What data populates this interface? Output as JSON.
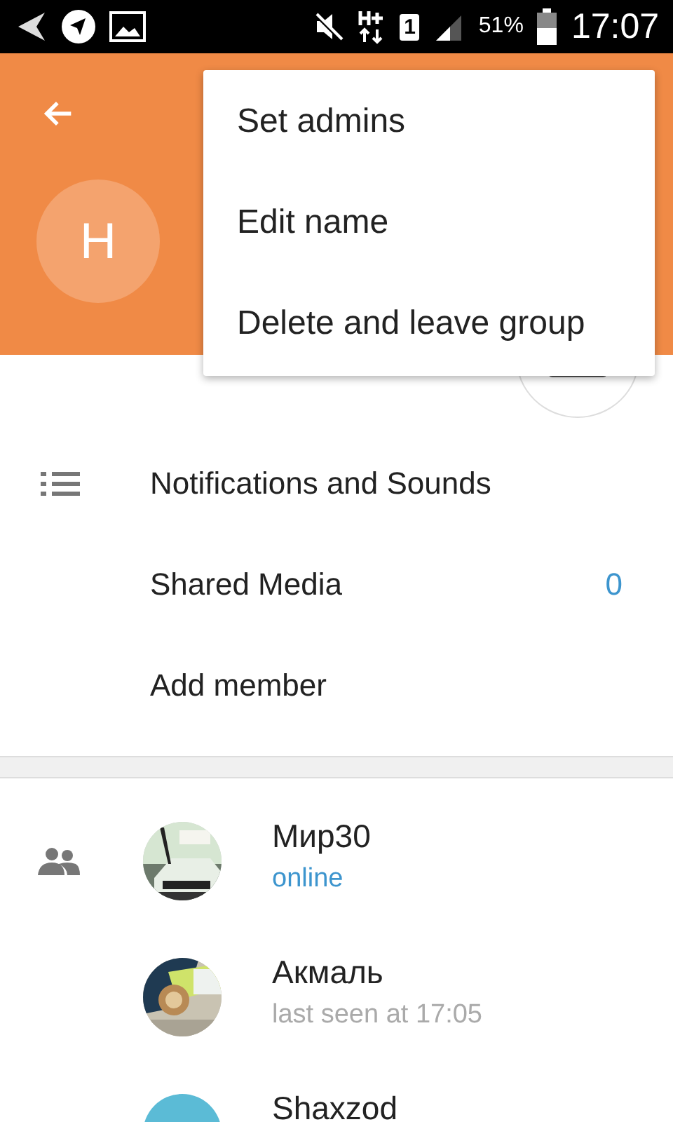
{
  "status_bar": {
    "sim": "1",
    "battery": "51%",
    "time": "17:07"
  },
  "header": {
    "avatar_letter": "H"
  },
  "menu": {
    "items": [
      {
        "label": "Set admins"
      },
      {
        "label": "Edit name"
      },
      {
        "label": "Delete and leave group"
      }
    ]
  },
  "settings": [
    {
      "kind": "icon",
      "label": "Notifications and Sounds"
    },
    {
      "kind": "plain",
      "label": "Shared Media",
      "count": "0"
    },
    {
      "kind": "plain",
      "label": "Add member"
    }
  ],
  "members": [
    {
      "kind": "picture",
      "name": "Мир30",
      "status": "online",
      "online": true
    },
    {
      "kind": "picture",
      "name": "Акмаль",
      "status": "last seen at 17:05",
      "online": false
    },
    {
      "kind": "letter",
      "name": "Shaxzod",
      "color": "#5bbbd6"
    }
  ]
}
